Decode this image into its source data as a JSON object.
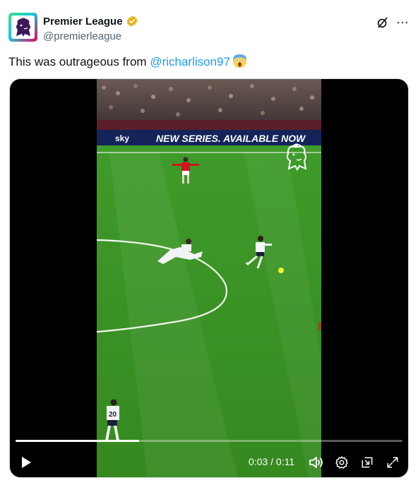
{
  "author": {
    "display_name": "Premier League",
    "handle": "@premierleague",
    "verified": true,
    "verified_color": "#e8b21b"
  },
  "actions": {
    "grok_icon": "grok-icon",
    "more_icon": "more-icon"
  },
  "tweet": {
    "text_prefix": "This was outrageous from ",
    "mention": "@richarlison97",
    "emoji": "😱"
  },
  "video": {
    "current_time": "0:03",
    "separator": " / ",
    "duration": "0:11",
    "progress": 0.32,
    "banner_text": "NEW SERIES. AVAILABLE NOW",
    "sponsor": "sky",
    "accent_color": "#1d9bf0"
  }
}
